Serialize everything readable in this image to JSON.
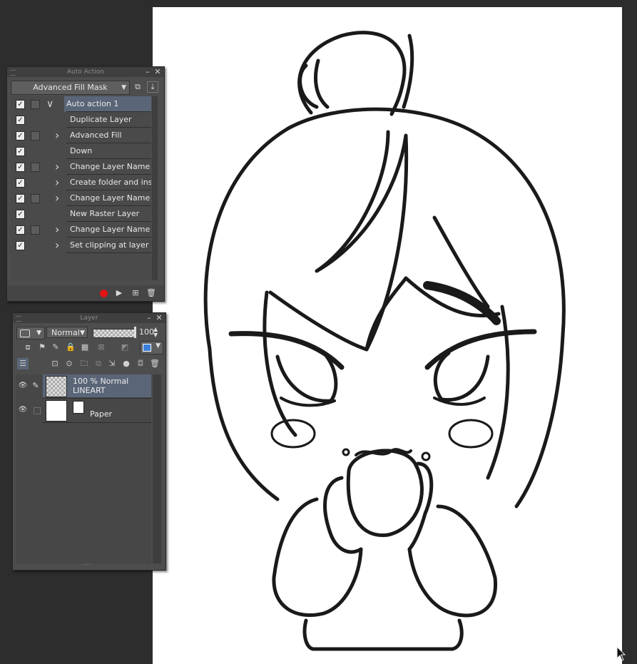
{
  "auto_action": {
    "title": "Auto Action",
    "set_name": "Advanced Fill Mask",
    "items": [
      {
        "label": "Auto action 1",
        "checked": true,
        "has_toggle": true,
        "expander": "open",
        "selected": true
      },
      {
        "label": "Duplicate Layer",
        "checked": true,
        "has_toggle": false,
        "expander": "none",
        "selected": false
      },
      {
        "label": "Advanced Fill",
        "checked": true,
        "has_toggle": true,
        "expander": "closed",
        "selected": false
      },
      {
        "label": "Down",
        "checked": true,
        "has_toggle": false,
        "expander": "none",
        "selected": false
      },
      {
        "label": "Change Layer Name",
        "checked": true,
        "has_toggle": true,
        "expander": "closed",
        "selected": false
      },
      {
        "label": "Create folder and insert l",
        "checked": true,
        "has_toggle": false,
        "expander": "closed",
        "selected": false
      },
      {
        "label": "Change Layer Name",
        "checked": true,
        "has_toggle": true,
        "expander": "closed",
        "selected": false
      },
      {
        "label": "New Raster Layer",
        "checked": true,
        "has_toggle": false,
        "expander": "none",
        "selected": false
      },
      {
        "label": "Change Layer Name",
        "checked": true,
        "has_toggle": true,
        "expander": "closed",
        "selected": false
      },
      {
        "label": "Set clipping at layer belo",
        "checked": true,
        "has_toggle": false,
        "expander": "closed",
        "selected": false
      }
    ]
  },
  "layer": {
    "title": "Layer",
    "blend_mode": "Normal",
    "opacity": "100",
    "layers": [
      {
        "line1": "100 % Normal",
        "line2": "LINEART",
        "type": "raster",
        "selected": true
      },
      {
        "line1": "",
        "line2": "Paper",
        "type": "paper",
        "selected": false
      }
    ]
  },
  "colors": {
    "record": "#e01414",
    "selection": "#5a6678"
  }
}
